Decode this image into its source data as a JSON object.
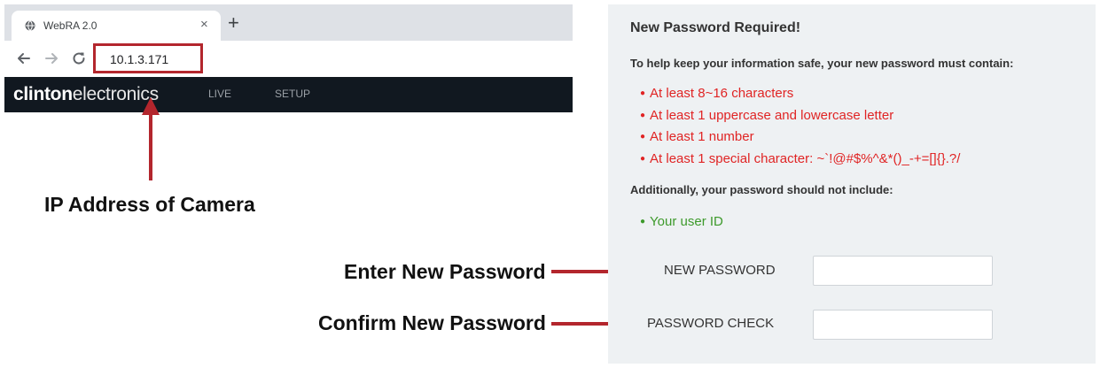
{
  "browser": {
    "tab_title": "WebRA 2.0",
    "tab_close": "×",
    "new_tab": "+",
    "url": "10.1.3.171",
    "favicon": "globe-icon",
    "nav_icons": [
      "back-arrow-icon",
      "forward-arrow-icon",
      "reload-icon"
    ]
  },
  "app": {
    "brand_bold": "clinton",
    "brand_thin": "electronics",
    "menu": [
      "LIVE",
      "SETUP"
    ]
  },
  "annotations": {
    "ip": "IP Address of Camera",
    "enter": "Enter New Password",
    "confirm": "Confirm New Password",
    "arrow_color": "#b3262d"
  },
  "panel": {
    "title": "New Password Required!",
    "intro": "To help keep your information safe, your new password must contain:",
    "requirements": [
      "At least 8~16 characters",
      "At least 1 uppercase and lowercase letter",
      "At least 1 number",
      "At least 1 special character: ~`!@#$%^&*()_-+=[]{}.?/"
    ],
    "additional_heading": "Additionally, your password should not include:",
    "exclusions": [
      "Your user ID"
    ],
    "new_password_label": "NEW PASSWORD",
    "new_password_value": "",
    "password_check_label": "PASSWORD CHECK",
    "password_check_value": "",
    "requirement_color": "#e02424",
    "exclusion_color": "#3d9a2b"
  }
}
